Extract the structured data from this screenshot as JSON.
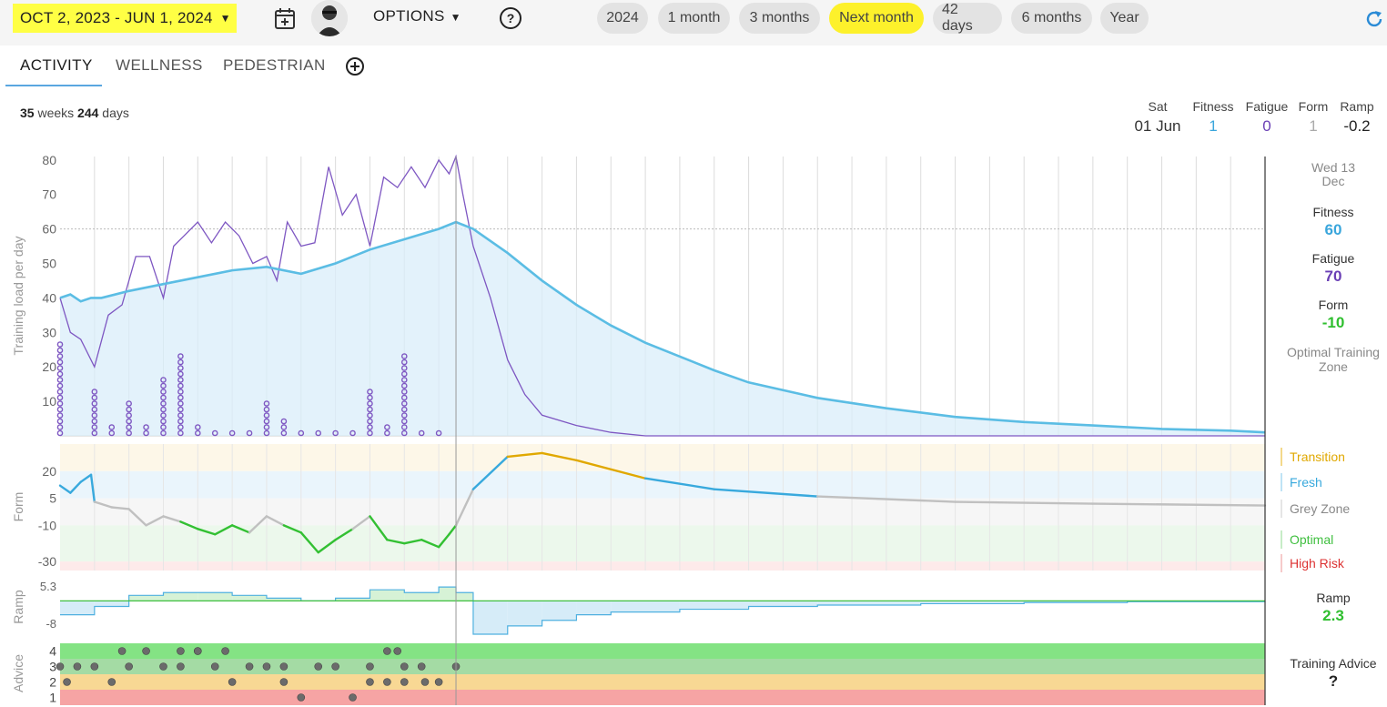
{
  "topbar": {
    "date_range": "OCT 2, 2023 - JUN 1, 2024",
    "options_label": "OPTIONS",
    "presets": [
      "2024",
      "1 month",
      "3 months",
      "Next month",
      "42 days",
      "6 months",
      "Year"
    ]
  },
  "tabs": [
    "ACTIVITY",
    "WELLNESS",
    "PEDESTRIAN"
  ],
  "summary": {
    "weeks": "35",
    "weeks_unit": "weeks",
    "days": "244",
    "days_unit": "days"
  },
  "header_readout": {
    "day": "Sat",
    "date": "01 Jun",
    "fitness_label": "Fitness",
    "fitness": "1",
    "fatigue_label": "Fatigue",
    "fatigue": "0",
    "form_label": "Form",
    "form": "1",
    "ramp_label": "Ramp",
    "ramp": "-0.2"
  },
  "side_panel": {
    "date_line1": "Wed 13",
    "date_line2": "Dec",
    "fitness_label": "Fitness",
    "fitness": "60",
    "fatigue_label": "Fatigue",
    "fatigue": "70",
    "form_label": "Form",
    "form": "-10",
    "zone_line1": "Optimal Training",
    "zone_line2": "Zone",
    "ramp_label": "Ramp",
    "ramp": "2.3",
    "advice_label": "Training Advice",
    "advice": "?"
  },
  "form_zones": [
    {
      "label": "Transition",
      "color": "#e0a800"
    },
    {
      "label": "Fresh",
      "color": "#38a9dd"
    },
    {
      "label": "Grey Zone",
      "color": "#888888"
    },
    {
      "label": "Optimal",
      "color": "#3fbf3f"
    },
    {
      "label": "High Risk",
      "color": "#dd3333"
    }
  ],
  "colors": {
    "fitness": "#5bbde4",
    "fatigue": "#7e57c2",
    "form_optimal": "#33c033",
    "form_grey": "#c0c0c0",
    "form_fresh": "#38a9dd",
    "form_transition": "#e0a800",
    "highlight": "#ffff44"
  },
  "icons": [
    "calendar-add-icon",
    "avatar",
    "help-icon",
    "add-tab-icon",
    "refresh-icon"
  ],
  "chart_data": [
    {
      "type": "line",
      "name": "Training load",
      "ylabel": "Training load per day",
      "yticks": [
        10,
        20,
        30,
        40,
        50,
        60,
        70,
        80
      ],
      "ylim": [
        0,
        81
      ],
      "x_unit": "week",
      "series": [
        {
          "name": "Fitness",
          "x": [
            0,
            0.3,
            0.6,
            0.9,
            1.2,
            2,
            3,
            4,
            5,
            6,
            7,
            8,
            9,
            10,
            11,
            11.5,
            12,
            13,
            14,
            15,
            16,
            17,
            18,
            19,
            20,
            22,
            24,
            26,
            28,
            30,
            32,
            34,
            35
          ],
          "y": [
            40,
            41,
            39,
            40,
            40,
            42,
            44,
            46,
            48,
            49,
            47,
            50,
            54,
            57,
            60,
            62,
            60,
            53,
            45,
            38,
            32,
            27,
            23,
            19,
            15.5,
            11,
            8,
            5.5,
            4,
            3,
            2,
            1.5,
            1
          ]
        },
        {
          "name": "Fatigue",
          "x": [
            0,
            0.3,
            0.6,
            1,
            1.4,
            1.8,
            2.2,
            2.6,
            3,
            3.3,
            3.6,
            4,
            4.4,
            4.8,
            5.2,
            5.6,
            6,
            6.3,
            6.6,
            7,
            7.4,
            7.8,
            8.2,
            8.6,
            9,
            9.4,
            9.8,
            10.2,
            10.6,
            11,
            11.3,
            11.5,
            11.7,
            12,
            12.5,
            13,
            13.5,
            14,
            15,
            16,
            17,
            18,
            35
          ],
          "y": [
            40,
            30,
            28,
            20,
            35,
            38,
            52,
            52,
            40,
            55,
            58,
            62,
            56,
            62,
            58,
            50,
            52,
            45,
            62,
            55,
            56,
            78,
            64,
            70,
            55,
            75,
            72,
            78,
            72,
            80,
            76,
            81,
            70,
            55,
            40,
            22,
            12,
            6,
            3,
            1,
            0,
            0,
            0
          ]
        },
        {
          "name": "Daily load",
          "type": "scatter",
          "x": [
            0,
            1,
            1.5,
            2,
            2.5,
            3,
            3.5,
            4,
            4.5,
            5,
            5.5,
            6,
            6.5,
            7,
            7.5,
            8,
            8.5,
            9,
            9.5,
            10,
            10.5,
            11
          ],
          "y": [
            40,
            20,
            5,
            15,
            5,
            25,
            35,
            5,
            0,
            0,
            0,
            15,
            8,
            0,
            0,
            0,
            0,
            20,
            5,
            35,
            0,
            0
          ]
        }
      ]
    },
    {
      "type": "line",
      "name": "Form",
      "ylabel": "Form",
      "yticks": [
        20,
        5,
        -10,
        -30
      ],
      "ylim": [
        -35,
        35
      ],
      "series": [
        {
          "name": "Form",
          "x": [
            0,
            0.3,
            0.6,
            0.9,
            1,
            1.5,
            2,
            2.5,
            3,
            3.5,
            4,
            4.5,
            5,
            5.5,
            6,
            6.5,
            7,
            7.5,
            8,
            8.5,
            9,
            9.5,
            10,
            10.5,
            11,
            11.3,
            11.5,
            12,
            13,
            14,
            15,
            17,
            19,
            22,
            26,
            30,
            35
          ],
          "y": [
            12,
            8,
            14,
            18,
            3,
            0,
            -1,
            -10,
            -5,
            -8,
            -12,
            -15,
            -10,
            -14,
            -5,
            -10,
            -14,
            -25,
            -18,
            -12,
            -5,
            -18,
            -20,
            -18,
            -22,
            -15,
            -10,
            10,
            28,
            30,
            26,
            16,
            10,
            6,
            3,
            2,
            1
          ]
        }
      ]
    },
    {
      "type": "area",
      "name": "Ramp",
      "ylabel": "Ramp",
      "yticks": [
        5.3,
        -8
      ],
      "ylim": [
        -12,
        8
      ],
      "series": [
        {
          "name": "Ramp",
          "x": [
            0,
            1,
            2,
            3,
            4,
            5,
            6,
            7,
            8,
            9,
            10,
            11,
            11.5,
            12,
            13,
            14,
            15,
            16,
            18,
            20,
            22,
            25,
            28,
            31,
            35
          ],
          "y": [
            -5,
            -2,
            2,
            3,
            3,
            2,
            1,
            0,
            1,
            4,
            3,
            5,
            3,
            -12,
            -9,
            -7,
            -5,
            -4,
            -3,
            -2,
            -1.5,
            -1,
            -0.6,
            -0.3,
            -0.2
          ]
        }
      ]
    },
    {
      "type": "scatter",
      "name": "Advice",
      "ylabel": "Advice",
      "yticks": [
        1,
        2,
        3,
        4
      ],
      "ylim": [
        0.5,
        4.5
      ],
      "series": [
        {
          "name": "Advice",
          "x": [
            0,
            0.2,
            0.5,
            1,
            1.5,
            2,
            2.5,
            3,
            3.5,
            4,
            4.5,
            5,
            5.5,
            6,
            6.5,
            7,
            7.5,
            8,
            8.5,
            9,
            9.5,
            10,
            10.5,
            11,
            11.5,
            1.8,
            3.5,
            4,
            4.8,
            6.5,
            9.5,
            9.8,
            9,
            10,
            10.6
          ],
          "y": [
            3,
            2,
            3,
            3,
            2,
            3,
            4,
            3,
            3,
            4,
            3,
            2,
            3,
            3,
            2,
            1,
            3,
            3,
            1,
            3,
            2,
            3,
            3,
            2,
            3,
            4,
            4,
            4,
            4,
            3,
            4,
            4,
            2,
            2,
            2
          ]
        }
      ]
    }
  ]
}
